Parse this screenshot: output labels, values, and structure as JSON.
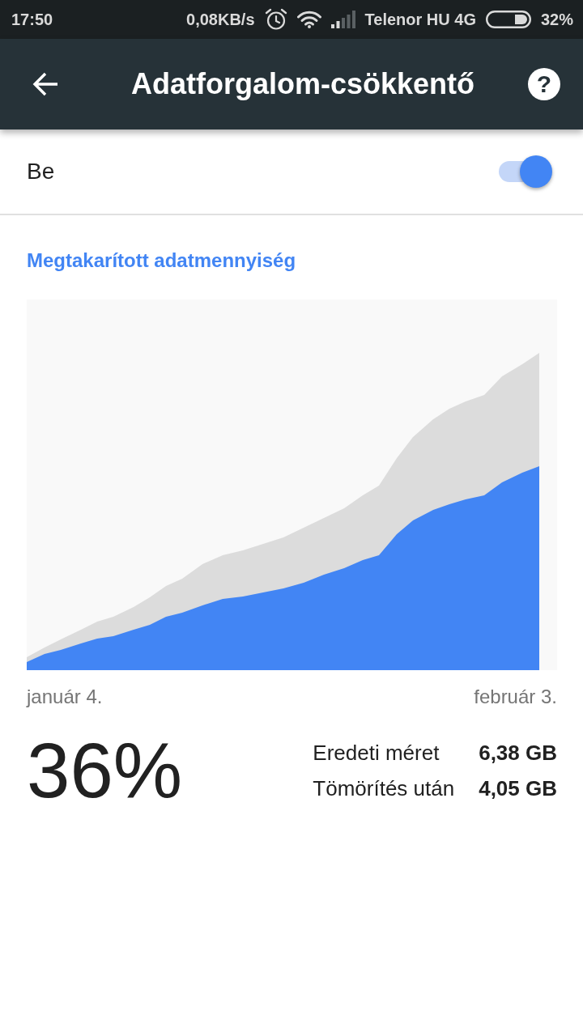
{
  "status_bar": {
    "time": "17:50",
    "net_speed": "0,08KB/s",
    "carrier": "Telenor HU 4G",
    "battery": "32%"
  },
  "app_bar": {
    "title": "Adatforgalom-csökkentő",
    "help": "?"
  },
  "toggle": {
    "label": "Be",
    "on": true
  },
  "savings": {
    "title": "Megtakarított adatmennyiség",
    "start_label": "január 4.",
    "end_label": "február 3.",
    "percent": "36%",
    "stats": [
      {
        "label": "Eredeti méret",
        "value": "6,38 GB"
      },
      {
        "label": "Tömörítés után",
        "value": "4,05 GB"
      }
    ]
  }
}
